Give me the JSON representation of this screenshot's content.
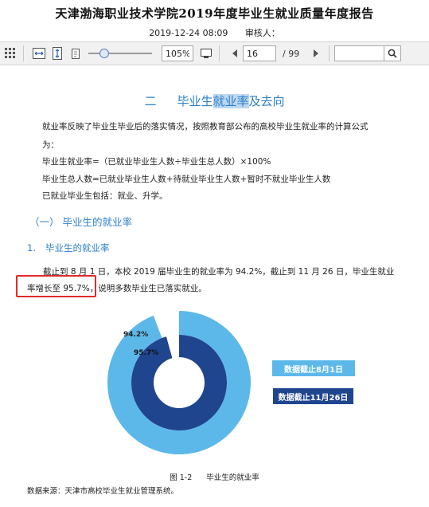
{
  "document": {
    "title": "天津渤海职业技术学院2019年度毕业生就业质量年度报告",
    "date": "2019-12-24 08:09",
    "reviewer": "审核人："
  },
  "toolbar": {
    "zoom": "105%",
    "current_page": "16",
    "total_pages": "/ 99",
    "search_value": "",
    "zoom_slider_level": 0.2
  },
  "content": {
    "section_number": "二",
    "section_title_pre": "毕业生",
    "section_title_hl": "就业率",
    "section_title_post": "及去向",
    "intro_line1": "就业率反映了毕业生毕业后的落实情况，按照教育部公布的高校毕业生就业率的计算公式",
    "intro_line2": "为：",
    "formula1": "毕业生就业率=（已就业毕业生人数÷毕业生总人数）×100%",
    "formula2": "毕业生总人数=已就业毕业生人数+待就业毕业生人数+暂时不就业毕业生人数",
    "formula3": "已就业毕业生包括：就业、升学。",
    "subheading1": "（一）  毕业生的就业率",
    "subheading2_num": "1.",
    "subheading2_text": "毕业生的就业率",
    "body_line1": "截止到 8 月 1 日，本校 2019 届毕业生的就业率为 94.2%，截止到 11 月 26 日，毕业生就业",
    "body_line2": "率增长至 95.7%，说明多数毕业生已落实就业。",
    "figure_number": "图 1-2",
    "figure_title": "毕业生的就业率",
    "source": "数据来源：天津市高校毕业生就业管理系统。"
  },
  "chart_data": {
    "type": "pie",
    "subtype": "nested-donut",
    "series": [
      {
        "name": "数据截止8月1日",
        "value": 94.2,
        "label": "94.2%",
        "color": "#5db8ea"
      },
      {
        "name": "数据截止11月26日",
        "value": 95.7,
        "label": "95.7%",
        "color": "#20458f"
      }
    ],
    "legend_position": "right"
  }
}
